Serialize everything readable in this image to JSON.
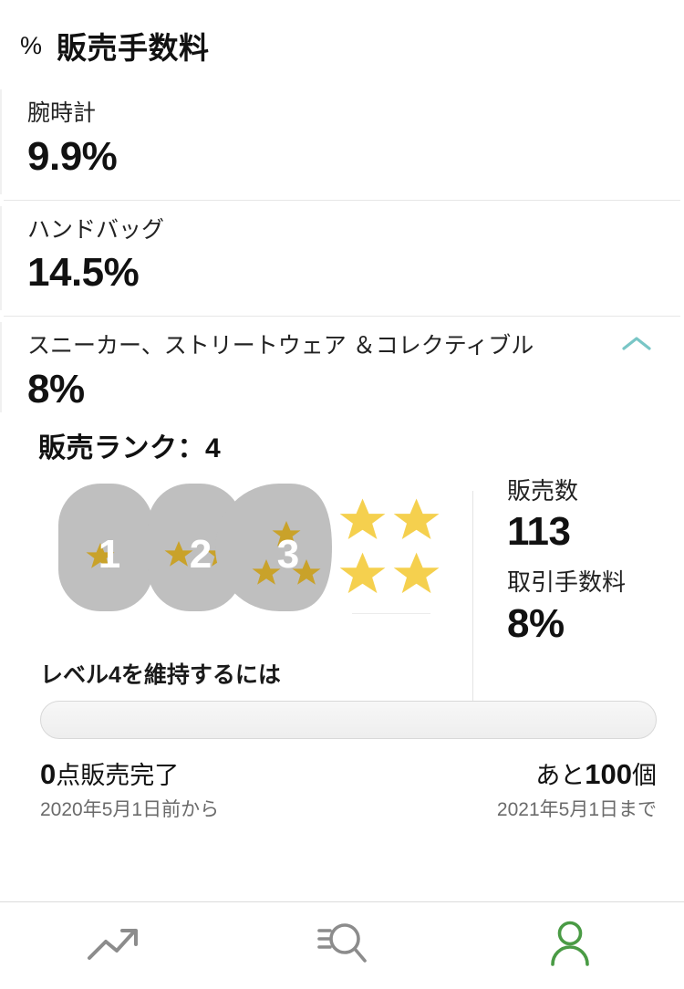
{
  "header": {
    "icon": "percent-icon",
    "icon_glyph": "%",
    "title": "販売手数料"
  },
  "fee_sections": [
    {
      "label": "腕時計",
      "value": "9.9%",
      "expanded": false
    },
    {
      "label": "ハンドバッグ",
      "value": "14.5%",
      "expanded": false
    },
    {
      "label": "スニーカー、ストリートウェア ＆コレクティブル",
      "value": "8%",
      "expanded": true
    }
  ],
  "rank_panel": {
    "rank_title": "販売ランク：4",
    "current_rank": 4,
    "badges": [
      {
        "number": "1",
        "stars": 1
      },
      {
        "number": "2",
        "stars": 2
      },
      {
        "number": "3",
        "stars": 3
      }
    ],
    "free_stars": 4,
    "stats": [
      {
        "label": "販売数",
        "value": "113"
      },
      {
        "label": "取引手数料",
        "value": "8%"
      }
    ]
  },
  "progress": {
    "title": "レベル4を維持するには",
    "percent": 0,
    "left_main_number": "0",
    "left_main_suffix": "点販売完了",
    "left_sub": "2020年5月1日前から",
    "right_prefix": "あと",
    "right_main_number": "100",
    "right_main_suffix": "個",
    "right_sub": "2021年5月1日まで"
  },
  "bottom_nav": [
    {
      "icon": "trending-up-icon",
      "active": false
    },
    {
      "icon": "search-list-icon",
      "active": false
    },
    {
      "icon": "person-icon",
      "active": true
    }
  ],
  "colors": {
    "accent_teal": "#79c6c6",
    "star_gold": "#f5d04e",
    "badge_star_gold": "#c9a22a",
    "badge_grey": "#bfbfbf",
    "nav_inactive": "#8c8c8c",
    "nav_active_green": "#4a9b45"
  }
}
